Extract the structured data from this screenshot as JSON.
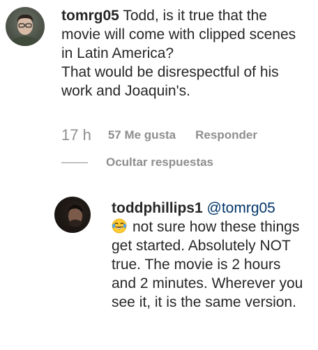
{
  "comment": {
    "username": "tomrg05",
    "text": "Todd, is it true that the movie will come with clipped scenes in Latin America?",
    "text2": "That would be disrespectful of his work and Joaquin's.",
    "timestamp": "17 h",
    "likes": "57 Me gusta",
    "reply_label": "Responder",
    "hide_replies_label": "Ocultar respuestas"
  },
  "reply": {
    "username": "toddphillips1",
    "mention": "@tomrg05",
    "emoji": "face-with-tears-of-joy",
    "text": "not sure how these things get started. Absolutely NOT true. The movie is 2 hours and 2 minutes. Wherever you see it, it is the same version."
  },
  "colors": {
    "text": "#262626",
    "secondary": "#8e8e8e",
    "mention": "#003569"
  }
}
